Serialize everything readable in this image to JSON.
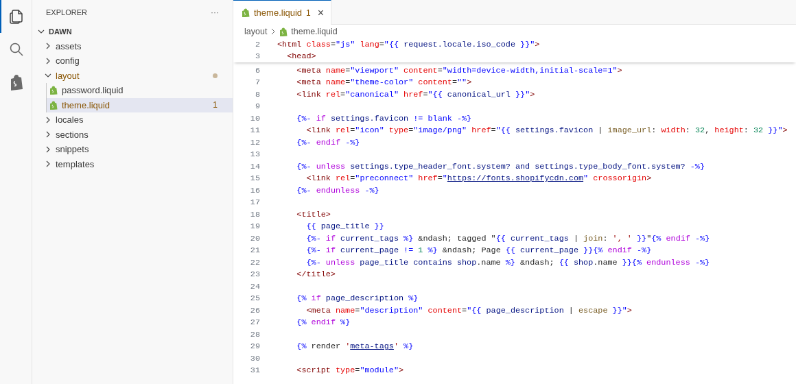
{
  "activity_bar": {
    "items": [
      {
        "kind": "files",
        "selected": true
      },
      {
        "kind": "search",
        "selected": false
      },
      {
        "kind": "bag",
        "selected": false
      }
    ]
  },
  "explorer": {
    "title": "EXPLORER",
    "more": "···",
    "root": {
      "label": "DAWN",
      "expanded": true,
      "children": [
        {
          "label": "assets",
          "kind": "folder",
          "expanded": false,
          "selected": false,
          "modified": false
        },
        {
          "label": "config",
          "kind": "folder",
          "expanded": false,
          "selected": false,
          "modified": false
        },
        {
          "label": "layout",
          "kind": "folder",
          "expanded": true,
          "selected": false,
          "modified": true,
          "children": [
            {
              "label": "password.liquid",
              "kind": "file",
              "selected": false,
              "modified": false
            },
            {
              "label": "theme.liquid",
              "kind": "file",
              "selected": true,
              "modified": true,
              "badge": "1"
            }
          ]
        },
        {
          "label": "locales",
          "kind": "folder",
          "expanded": false,
          "selected": false,
          "modified": false
        },
        {
          "label": "sections",
          "kind": "folder",
          "expanded": false,
          "selected": false,
          "modified": false
        },
        {
          "label": "snippets",
          "kind": "folder",
          "expanded": false,
          "selected": false,
          "modified": false
        },
        {
          "label": "templates",
          "kind": "folder",
          "expanded": false,
          "selected": false,
          "modified": false
        }
      ]
    }
  },
  "tabs": [
    {
      "label": "theme.liquid",
      "badge": "1",
      "close": "×",
      "selected": true
    }
  ],
  "breadcrumbs": [
    "layout",
    "theme.liquid"
  ],
  "sticky_lines": [
    {
      "n": "2",
      "tokens": [
        {
          "kind": "tag",
          "text": "<html "
        },
        {
          "kind": "attr",
          "text": "class"
        },
        {
          "kind": "txt",
          "text": "="
        },
        {
          "kind": "str",
          "text": "\"js\" "
        },
        {
          "kind": "attr",
          "text": "lang"
        },
        {
          "kind": "txt",
          "text": "="
        },
        {
          "kind": "str",
          "text": "\"{{"
        },
        {
          "kind": "var",
          "text": " request.locale.iso_code "
        },
        {
          "kind": "str",
          "text": "}}\""
        },
        {
          "kind": "tag",
          "text": ">"
        }
      ]
    },
    {
      "n": "3",
      "tokens": [
        {
          "kind": "tag",
          "text": "  <head>"
        }
      ]
    }
  ],
  "lines": [
    {
      "n": "6",
      "tokens": [
        {
          "kind": "tag",
          "text": "    <meta "
        },
        {
          "kind": "attr",
          "text": "name"
        },
        {
          "kind": "txt",
          "text": "="
        },
        {
          "kind": "str",
          "text": "\"viewport\" "
        },
        {
          "kind": "attr",
          "text": "content"
        },
        {
          "kind": "txt",
          "text": "="
        },
        {
          "kind": "str",
          "text": "\"width=device-width,initial-scale=1\""
        },
        {
          "kind": "tag",
          "text": ">"
        }
      ]
    },
    {
      "n": "7",
      "tokens": [
        {
          "kind": "tag",
          "text": "    <meta "
        },
        {
          "kind": "attr",
          "text": "name"
        },
        {
          "kind": "txt",
          "text": "="
        },
        {
          "kind": "str",
          "text": "\"theme-color\" "
        },
        {
          "kind": "attr",
          "text": "content"
        },
        {
          "kind": "txt",
          "text": "="
        },
        {
          "kind": "str",
          "text": "\"\""
        },
        {
          "kind": "tag",
          "text": ">"
        }
      ]
    },
    {
      "n": "8",
      "tokens": [
        {
          "kind": "tag",
          "text": "    <link "
        },
        {
          "kind": "attr",
          "text": "rel"
        },
        {
          "kind": "txt",
          "text": "="
        },
        {
          "kind": "str",
          "text": "\"canonical\" "
        },
        {
          "kind": "attr",
          "text": "href"
        },
        {
          "kind": "txt",
          "text": "="
        },
        {
          "kind": "str",
          "text": "\"{{"
        },
        {
          "kind": "var",
          "text": " canonical_url "
        },
        {
          "kind": "str",
          "text": "}}\""
        },
        {
          "kind": "tag",
          "text": ">"
        }
      ]
    },
    {
      "n": "9"
    },
    {
      "n": "10",
      "tokens": [
        {
          "kind": "delim",
          "text": "    {%-"
        },
        {
          "kind": "kw",
          "text": " if"
        },
        {
          "kind": "var",
          "text": " settings.favicon"
        },
        {
          "kind": "delim",
          "text": " != blank -%}"
        }
      ]
    },
    {
      "n": "11",
      "tokens": [
        {
          "kind": "tag",
          "text": "      <link "
        },
        {
          "kind": "attr",
          "text": "rel"
        },
        {
          "kind": "txt",
          "text": "="
        },
        {
          "kind": "str",
          "text": "\"icon\" "
        },
        {
          "kind": "attr",
          "text": "type"
        },
        {
          "kind": "txt",
          "text": "="
        },
        {
          "kind": "str",
          "text": "\"image/png\" "
        },
        {
          "kind": "attr",
          "text": "href"
        },
        {
          "kind": "txt",
          "text": "="
        },
        {
          "kind": "str",
          "text": "\"{{"
        },
        {
          "kind": "var",
          "text": " settings.favicon "
        },
        {
          "kind": "txt",
          "text": "| "
        },
        {
          "kind": "fn",
          "text": "image_url"
        },
        {
          "kind": "txt",
          "text": ": "
        },
        {
          "kind": "attr",
          "text": "width"
        },
        {
          "kind": "txt",
          "text": ": "
        },
        {
          "kind": "num",
          "text": "32"
        },
        {
          "kind": "txt",
          "text": ", "
        },
        {
          "kind": "attr",
          "text": "height"
        },
        {
          "kind": "txt",
          "text": ": "
        },
        {
          "kind": "num",
          "text": "32"
        },
        {
          "kind": "str",
          "text": " }}\""
        },
        {
          "kind": "tag",
          "text": ">"
        }
      ]
    },
    {
      "n": "12",
      "tokens": [
        {
          "kind": "delim",
          "text": "    {%-"
        },
        {
          "kind": "kw",
          "text": " endif"
        },
        {
          "kind": "delim",
          "text": " -%}"
        }
      ]
    },
    {
      "n": "13"
    },
    {
      "n": "14",
      "tokens": [
        {
          "kind": "delim",
          "text": "    {%-"
        },
        {
          "kind": "kw",
          "text": " unless"
        },
        {
          "kind": "var",
          "text": " settings.type_header_font.system? and settings.type_body_font.system?"
        },
        {
          "kind": "delim",
          "text": " -%}"
        }
      ]
    },
    {
      "n": "15",
      "tokens": [
        {
          "kind": "tag",
          "text": "      <link "
        },
        {
          "kind": "attr",
          "text": "rel"
        },
        {
          "kind": "txt",
          "text": "="
        },
        {
          "kind": "str",
          "text": "\"preconnect\" "
        },
        {
          "kind": "attr",
          "text": "href"
        },
        {
          "kind": "txt",
          "text": "="
        },
        {
          "kind": "str",
          "text": "\""
        },
        {
          "kind": "link",
          "text": "https://fonts.shopifycdn.com"
        },
        {
          "kind": "str",
          "text": "\" "
        },
        {
          "kind": "attr",
          "text": "crossorigin"
        },
        {
          "kind": "tag",
          "text": ">"
        }
      ]
    },
    {
      "n": "16",
      "tokens": [
        {
          "kind": "delim",
          "text": "    {%-"
        },
        {
          "kind": "kw",
          "text": " endunless"
        },
        {
          "kind": "delim",
          "text": " -%}"
        }
      ]
    },
    {
      "n": "17"
    },
    {
      "n": "18",
      "tokens": [
        {
          "kind": "tag",
          "text": "    <title>"
        }
      ]
    },
    {
      "n": "19",
      "tokens": [
        {
          "kind": "delim",
          "text": "      {{"
        },
        {
          "kind": "var",
          "text": " page_title "
        },
        {
          "kind": "delim",
          "text": "}}"
        }
      ]
    },
    {
      "n": "20",
      "tokens": [
        {
          "kind": "delim",
          "text": "      {%-"
        },
        {
          "kind": "kw",
          "text": " if"
        },
        {
          "kind": "var",
          "text": " current_tags "
        },
        {
          "kind": "delim",
          "text": "%}"
        },
        {
          "kind": "txt",
          "text": " &ndash; tagged \""
        },
        {
          "kind": "delim",
          "text": "{{"
        },
        {
          "kind": "var",
          "text": " current_tags "
        },
        {
          "kind": "txt",
          "text": "| "
        },
        {
          "kind": "fn",
          "text": "join"
        },
        {
          "kind": "txt",
          "text": ": "
        },
        {
          "kind": "lstr",
          "text": "', '"
        },
        {
          "kind": "delim",
          "text": " }}"
        },
        {
          "kind": "txt",
          "text": "\""
        },
        {
          "kind": "delim",
          "text": "{%"
        },
        {
          "kind": "kw",
          "text": " endif"
        },
        {
          "kind": "delim",
          "text": " -%}"
        }
      ]
    },
    {
      "n": "21",
      "tokens": [
        {
          "kind": "delim",
          "text": "      {%-"
        },
        {
          "kind": "kw",
          "text": " if"
        },
        {
          "kind": "var",
          "text": " current_page "
        },
        {
          "kind": "delim",
          "text": "!= "
        },
        {
          "kind": "num",
          "text": "1"
        },
        {
          "kind": "delim",
          "text": " %}"
        },
        {
          "kind": "txt",
          "text": " &ndash; Page "
        },
        {
          "kind": "delim",
          "text": "{{"
        },
        {
          "kind": "var",
          "text": " current_page "
        },
        {
          "kind": "delim",
          "text": "}}{%"
        },
        {
          "kind": "kw",
          "text": " endif"
        },
        {
          "kind": "delim",
          "text": " -%}"
        }
      ]
    },
    {
      "n": "22",
      "tokens": [
        {
          "kind": "delim",
          "text": "      {%-"
        },
        {
          "kind": "kw",
          "text": " unless"
        },
        {
          "kind": "var",
          "text": " page_title contains shop"
        },
        {
          "kind": "txt",
          "text": ".name "
        },
        {
          "kind": "delim",
          "text": "%}"
        },
        {
          "kind": "txt",
          "text": " &ndash; "
        },
        {
          "kind": "delim",
          "text": "{{"
        },
        {
          "kind": "var",
          "text": " shop"
        },
        {
          "kind": "txt",
          "text": ".name "
        },
        {
          "kind": "delim",
          "text": "}}{%"
        },
        {
          "kind": "kw",
          "text": " endunless"
        },
        {
          "kind": "delim",
          "text": " -%}"
        }
      ]
    },
    {
      "n": "23",
      "tokens": [
        {
          "kind": "tag",
          "text": "    </title>"
        }
      ]
    },
    {
      "n": "24"
    },
    {
      "n": "25",
      "tokens": [
        {
          "kind": "delim",
          "text": "    {%"
        },
        {
          "kind": "kw",
          "text": " if"
        },
        {
          "kind": "var",
          "text": " page_description "
        },
        {
          "kind": "delim",
          "text": "%}"
        }
      ]
    },
    {
      "n": "26",
      "tokens": [
        {
          "kind": "tag",
          "text": "      <meta "
        },
        {
          "kind": "attr",
          "text": "name"
        },
        {
          "kind": "txt",
          "text": "="
        },
        {
          "kind": "str",
          "text": "\"description\" "
        },
        {
          "kind": "attr",
          "text": "content"
        },
        {
          "kind": "txt",
          "text": "="
        },
        {
          "kind": "str",
          "text": "\"{{"
        },
        {
          "kind": "var",
          "text": " page_description "
        },
        {
          "kind": "txt",
          "text": "| "
        },
        {
          "kind": "fn",
          "text": "escape"
        },
        {
          "kind": "str",
          "text": " }}\""
        },
        {
          "kind": "tag",
          "text": ">"
        }
      ]
    },
    {
      "n": "27",
      "tokens": [
        {
          "kind": "delim",
          "text": "    {%"
        },
        {
          "kind": "kw",
          "text": " endif"
        },
        {
          "kind": "delim",
          "text": " %}"
        }
      ]
    },
    {
      "n": "28"
    },
    {
      "n": "29",
      "tokens": [
        {
          "kind": "delim",
          "text": "    {%"
        },
        {
          "kind": "txt",
          "text": " render "
        },
        {
          "kind": "lstr",
          "text": "'"
        },
        {
          "kind": "link",
          "text": "meta-tags"
        },
        {
          "kind": "lstr",
          "text": "'"
        },
        {
          "kind": "delim",
          "text": " %}"
        }
      ]
    },
    {
      "n": "30"
    },
    {
      "n": "31",
      "tokens": [
        {
          "kind": "tag",
          "text": "    <script "
        },
        {
          "kind": "attr",
          "text": "type"
        },
        {
          "kind": "txt",
          "text": "="
        },
        {
          "kind": "str",
          "text": "\"module\""
        },
        {
          "kind": "tag",
          "text": ">"
        }
      ]
    }
  ]
}
